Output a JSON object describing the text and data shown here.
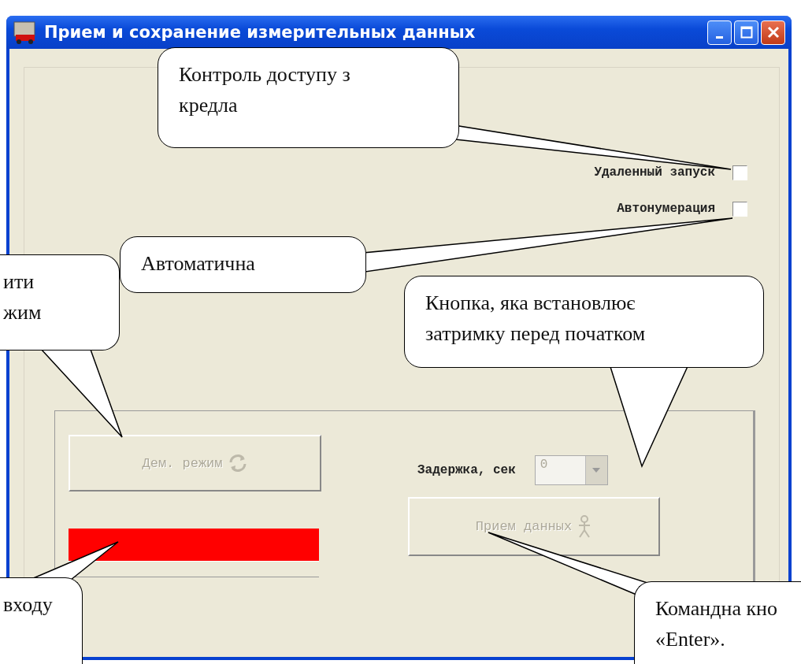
{
  "window": {
    "title": "Прием и сохранение измерительных данных"
  },
  "options": [
    {
      "label": "Удаленный запуск",
      "checked": false
    },
    {
      "label": "Автонумерация",
      "checked": false
    }
  ],
  "mode_button": {
    "label": "Дем. режим",
    "disabled": true
  },
  "delay": {
    "label": "Задержка, сек",
    "value": "0",
    "disabled": true
  },
  "receive_button": {
    "label": "Прием данных",
    "disabled": true
  },
  "callouts": [
    {
      "text": "Контроль доступу з\nкредла"
    },
    {
      "text": "Автоматична"
    },
    {
      "text": "ити\nжим"
    },
    {
      "text": "Кнопка, яка встановлює\nзатримку перед початком"
    },
    {
      "text": "входу"
    },
    {
      "text": "Командна кно\n«Enter»."
    }
  ]
}
